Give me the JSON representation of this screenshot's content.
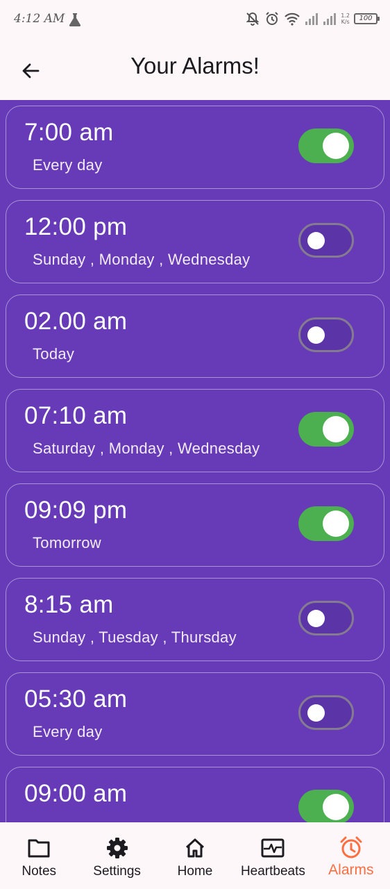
{
  "status_bar": {
    "time": "4:12 AM",
    "speed_top": "1.2",
    "speed_bottom": "K/s",
    "battery": "100"
  },
  "app_bar": {
    "title": "Your Alarms!"
  },
  "alarms": [
    {
      "time": "7:00 am",
      "days": "Every day",
      "enabled": true
    },
    {
      "time": "12:00 pm",
      "days": "Sunday , Monday , Wednesday",
      "enabled": false
    },
    {
      "time": "02.00 am",
      "days": "Today",
      "enabled": false
    },
    {
      "time": "07:10 am",
      "days": "Saturday , Monday , Wednesday",
      "enabled": true
    },
    {
      "time": "09:09 pm",
      "days": "Tomorrow",
      "enabled": true
    },
    {
      "time": "8:15 am",
      "days": "Sunday , Tuesday , Thursday",
      "enabled": false
    },
    {
      "time": "05:30 am",
      "days": "Every day",
      "enabled": false
    },
    {
      "time": "09:00 am",
      "days": "",
      "enabled": true
    }
  ],
  "bottom_nav": {
    "items": [
      {
        "label": "Notes",
        "icon": "folder-icon"
      },
      {
        "label": "Settings",
        "icon": "gear-icon"
      },
      {
        "label": "Home",
        "icon": "home-icon"
      },
      {
        "label": "Heartbeats",
        "icon": "heartbeat-icon"
      },
      {
        "label": "Alarms",
        "icon": "alarm-clock-icon",
        "active": true
      }
    ]
  },
  "colors": {
    "list_background": "#673ab7",
    "toggle_on": "#4caf50",
    "active_nav": "#ff6e40",
    "app_bar": "#fef7fa"
  }
}
